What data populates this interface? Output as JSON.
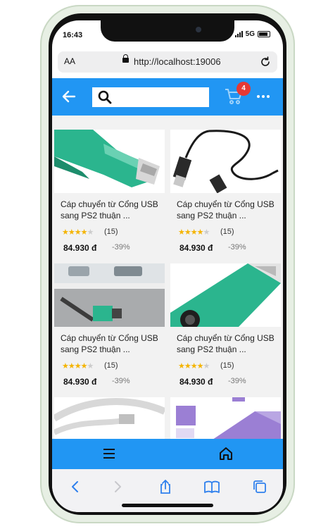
{
  "status_bar": {
    "time": "16:43",
    "network": "5G"
  },
  "browser": {
    "text_size_label": "AA",
    "url": "http://localhost:19006"
  },
  "app_bar": {
    "search_placeholder": "",
    "cart_count": "4"
  },
  "products": [
    {
      "title": "Cáp chuyển từ Cổng USB sang PS2 thuận ...",
      "stars": "★★★★",
      "stars_off": "★",
      "rating_count": "(15)",
      "price": "84.930 đ",
      "discount": "-39%"
    },
    {
      "title": "Cáp chuyển từ Cổng USB sang PS2 thuận ...",
      "stars": "★★★★",
      "stars_off": "★",
      "rating_count": "(15)",
      "price": "84.930 đ",
      "discount": "-39%"
    },
    {
      "title": "Cáp chuyển từ Cổng USB sang PS2 thuận ...",
      "stars": "★★★★",
      "stars_off": "★",
      "rating_count": "(15)",
      "price": "84.930 đ",
      "discount": "-39%"
    },
    {
      "title": "Cáp chuyển từ Cổng USB sang PS2 thuận ...",
      "stars": "★★★★",
      "stars_off": "★",
      "rating_count": "(15)",
      "price": "84.930 đ",
      "discount": "-39%"
    }
  ],
  "colors": {
    "primary": "#2196f3",
    "badge": "#e53935",
    "star": "#f4b400",
    "adapter_green": "#2bb58e",
    "adapter_purple": "#9b7fd4"
  }
}
